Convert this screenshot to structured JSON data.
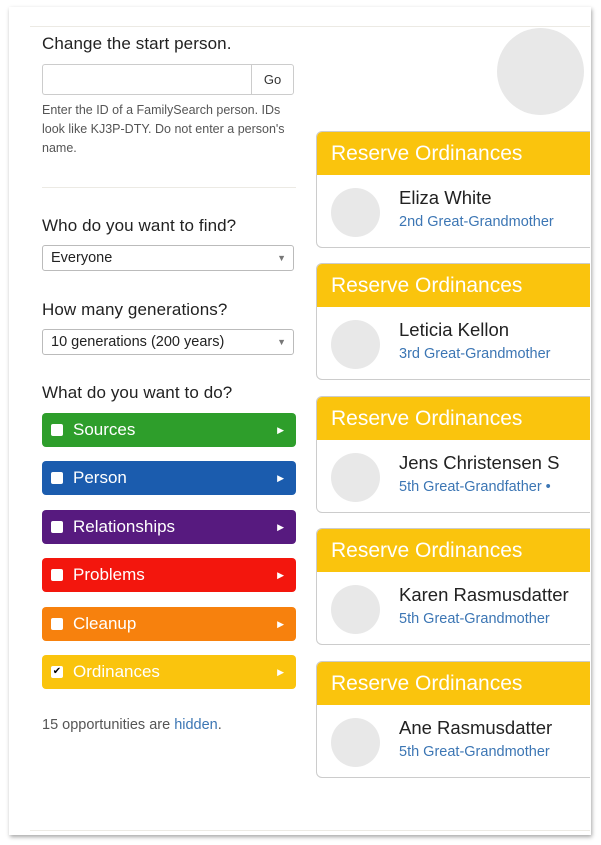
{
  "start_person": {
    "heading": "Change the start person.",
    "input_value": "",
    "input_placeholder": "",
    "go_label": "Go",
    "help_text": "Enter the ID of a FamilySearch person. IDs look like KJ3P-DTY. Do not enter a person's name."
  },
  "find": {
    "heading": "Who do you want to find?",
    "selected": "Everyone"
  },
  "generations": {
    "heading": "How many generations?",
    "selected": "10 generations (200 years)"
  },
  "actions": {
    "heading": "What do you want to do?",
    "categories": [
      {
        "label": "Sources",
        "color": "#2e9e2b",
        "checked": false
      },
      {
        "label": "Person",
        "color": "#1b5cae",
        "checked": false
      },
      {
        "label": "Relationships",
        "color": "#571a7f",
        "checked": false
      },
      {
        "label": "Problems",
        "color": "#f3160d",
        "checked": false
      },
      {
        "label": "Cleanup",
        "color": "#f7810d",
        "checked": false
      },
      {
        "label": "Ordinances",
        "color": "#fac40d",
        "checked": true
      }
    ]
  },
  "hidden_note": {
    "prefix": "15 opportunities are ",
    "link": "hidden",
    "suffix": "."
  },
  "icons": {
    "checkmark": "✔",
    "arrow": "▶",
    "caret": "▼"
  },
  "cards": [
    {
      "title": "Reserve Ordinances",
      "name": "Eliza White",
      "relationship": "2nd Great-Grandmother"
    },
    {
      "title": "Reserve Ordinances",
      "name": "Leticia Kellon",
      "relationship": "3rd Great-Grandmother"
    },
    {
      "title": "Reserve Ordinances",
      "name": "Jens Christensen S",
      "relationship": "5th Great-Grandfather •"
    },
    {
      "title": "Reserve Ordinances",
      "name": "Karen Rasmusdatter",
      "relationship": "5th Great-Grandmother"
    },
    {
      "title": "Reserve Ordinances",
      "name": "Ane Rasmusdatter",
      "relationship": "5th Great-Grandmother"
    }
  ]
}
